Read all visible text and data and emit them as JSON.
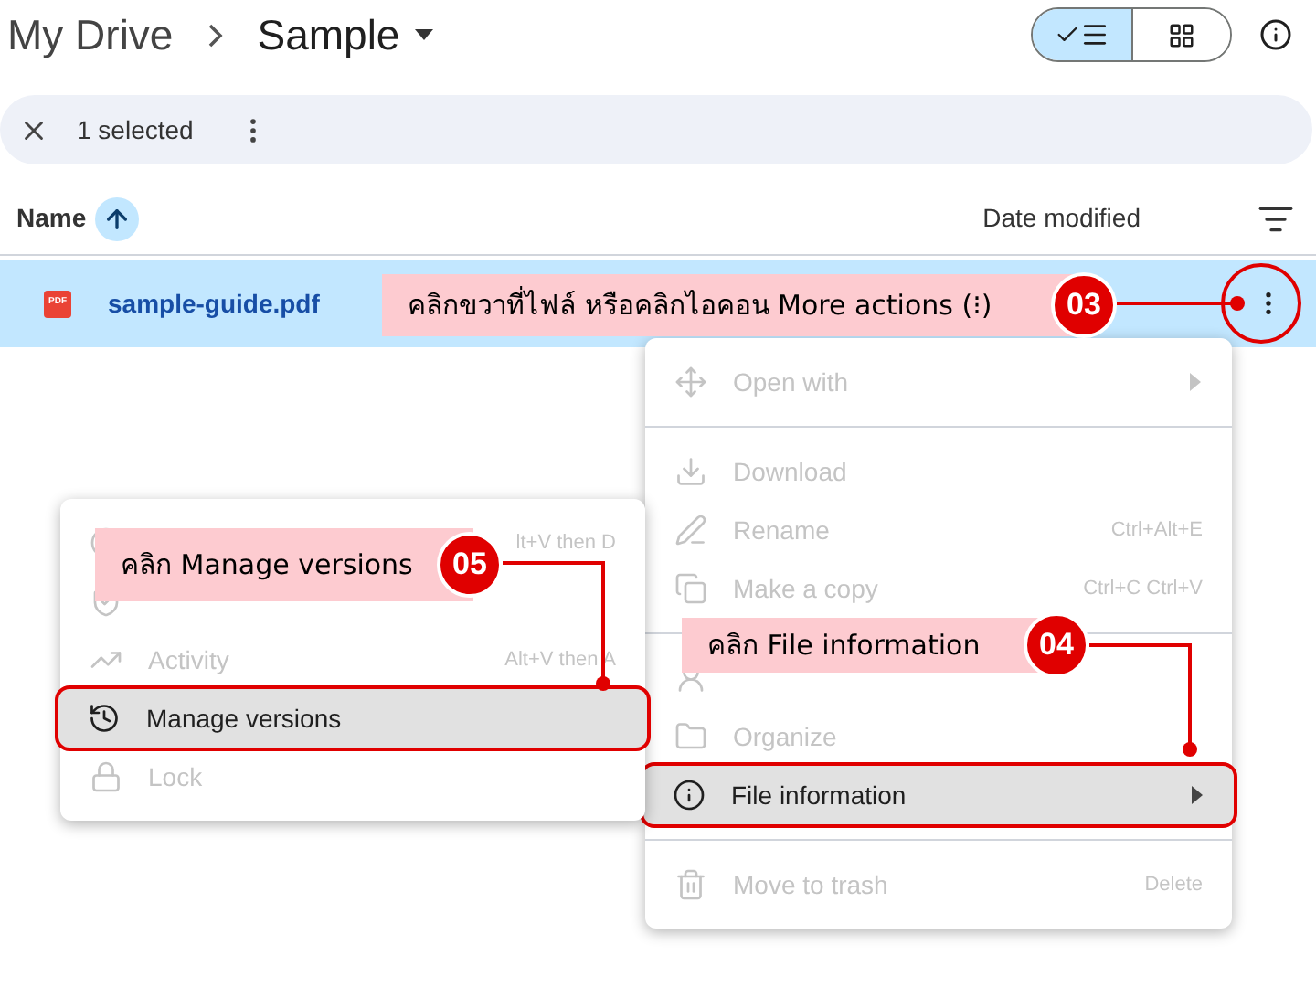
{
  "header": {
    "breadcrumb": [
      {
        "label": "My Drive"
      },
      {
        "label": "Sample"
      }
    ],
    "view_toggle": [
      {
        "kind": "list",
        "selected": true
      },
      {
        "kind": "grid",
        "selected": false
      }
    ]
  },
  "selection_bar": {
    "count": "1 selected"
  },
  "columns": [
    {
      "label": "Name"
    },
    {
      "label": "Date modified"
    }
  ],
  "files": [
    {
      "name": "sample-guide.pdf",
      "file_badge": "PDF",
      "selected": true
    }
  ],
  "context_menu": [
    {
      "kind": "item",
      "label": "Open with",
      "disabled": true,
      "submenu": true,
      "highlighted": false
    },
    {
      "kind": "divider"
    },
    {
      "kind": "item",
      "label": "Download",
      "disabled": true,
      "submenu": false,
      "highlighted": false
    },
    {
      "kind": "item",
      "label": "Rename",
      "shortcut": "Ctrl+Alt+E",
      "disabled": true,
      "submenu": false,
      "highlighted": false
    },
    {
      "kind": "item",
      "label": "Make a copy",
      "shortcut": "Ctrl+C Ctrl+V",
      "disabled": true,
      "submenu": false,
      "highlighted": false
    },
    {
      "kind": "divider"
    },
    {
      "kind": "item",
      "disabled": true,
      "highlighted": false
    },
    {
      "kind": "item",
      "label": "Organize",
      "disabled": true,
      "submenu": false,
      "highlighted": false
    },
    {
      "kind": "item",
      "label": "File information",
      "disabled": false,
      "submenu": true,
      "highlighted": true
    },
    {
      "kind": "divider"
    },
    {
      "kind": "item",
      "label": "Move to trash",
      "shortcut": "Delete",
      "disabled": true,
      "submenu": false,
      "highlighted": false
    }
  ],
  "submenu": [
    {
      "kind": "item",
      "shortcut": "lt+V then D",
      "disabled": true,
      "highlighted": false
    },
    {
      "kind": "item",
      "disabled": true,
      "highlighted": false
    },
    {
      "kind": "item",
      "label": "Activity",
      "shortcut": "Alt+V then A",
      "disabled": true,
      "highlighted": false
    },
    {
      "kind": "item",
      "label": "Manage versions",
      "disabled": false,
      "highlighted": true
    },
    {
      "kind": "item",
      "label": "Lock",
      "disabled": true,
      "highlighted": false
    }
  ],
  "callouts": [
    {
      "step": "03",
      "text": "คลิกขวาที่ไฟล์ หรือคลิกไอคอน More actions (⁝)"
    },
    {
      "step": "04",
      "text": "คลิก File information"
    },
    {
      "step": "05",
      "text": "คลิก Manage versions"
    }
  ]
}
